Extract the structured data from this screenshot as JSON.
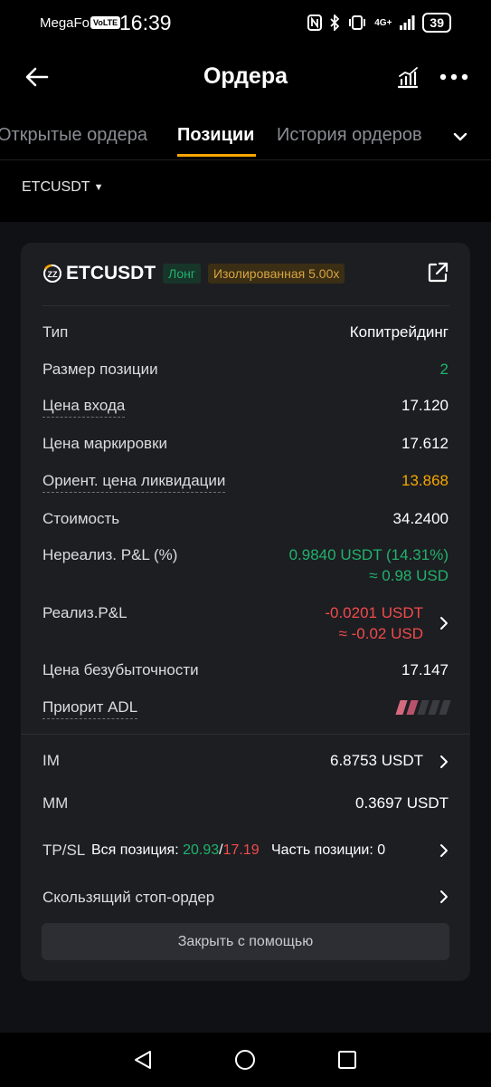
{
  "status_bar": {
    "carrier": "MegaFon",
    "volte": "VoLTE",
    "time": "16:39",
    "network": "4G+",
    "battery": "39"
  },
  "header": {
    "title": "Ордера"
  },
  "tabs": [
    {
      "label": "Открытые ордера"
    },
    {
      "label": "Позиции"
    },
    {
      "label": "История ордеров"
    }
  ],
  "filter": {
    "symbol": "ETCUSDT"
  },
  "position": {
    "symbol": "ETCUSDT",
    "side": "Лонг",
    "margin_mode": "Изолированная 5.00x",
    "rows": {
      "type": {
        "label": "Тип",
        "value": "Копитрейдинг"
      },
      "size": {
        "label": "Размер позиции",
        "value": "2"
      },
      "entry": {
        "label": "Цена входа",
        "value": "17.120"
      },
      "mark": {
        "label": "Цена маркировки",
        "value": "17.612"
      },
      "liq": {
        "label": "Ориент. цена ликвидации",
        "value": "13.868"
      },
      "value": {
        "label": "Стоимость",
        "value": "34.2400"
      },
      "upnl": {
        "label": "Нереализ. P&L (%)",
        "value": "0.9840 USDT (14.31%)",
        "value2": "≈ 0.98 USD"
      },
      "rpnl": {
        "label": "Реализ.P&L",
        "value": "-0.0201 USDT",
        "value2": "≈ -0.02 USD"
      },
      "breakeven": {
        "label": "Цена безубыточности",
        "value": "17.147"
      },
      "adl": {
        "label": "Приорит ADL",
        "level": 2,
        "max": 5
      }
    },
    "im": {
      "label": "IM",
      "value": "6.8753 USDT"
    },
    "mm": {
      "label": "MM",
      "value": "0.3697 USDT"
    },
    "tpsl": {
      "label": "TP/SL",
      "whole_label": "Вся позиция:",
      "tp": "20.93",
      "sep": "/",
      "sl": "17.19",
      "partial_label": "Часть позиции:",
      "partial_count": "0"
    },
    "trailing": {
      "label": "Скользящий стоп-ордер"
    },
    "close_button": "Закрыть с помощью"
  },
  "colors": {
    "accent": "#f7a600",
    "green": "#20b26c",
    "red": "#f04b4b",
    "card": "#1d1e22"
  }
}
